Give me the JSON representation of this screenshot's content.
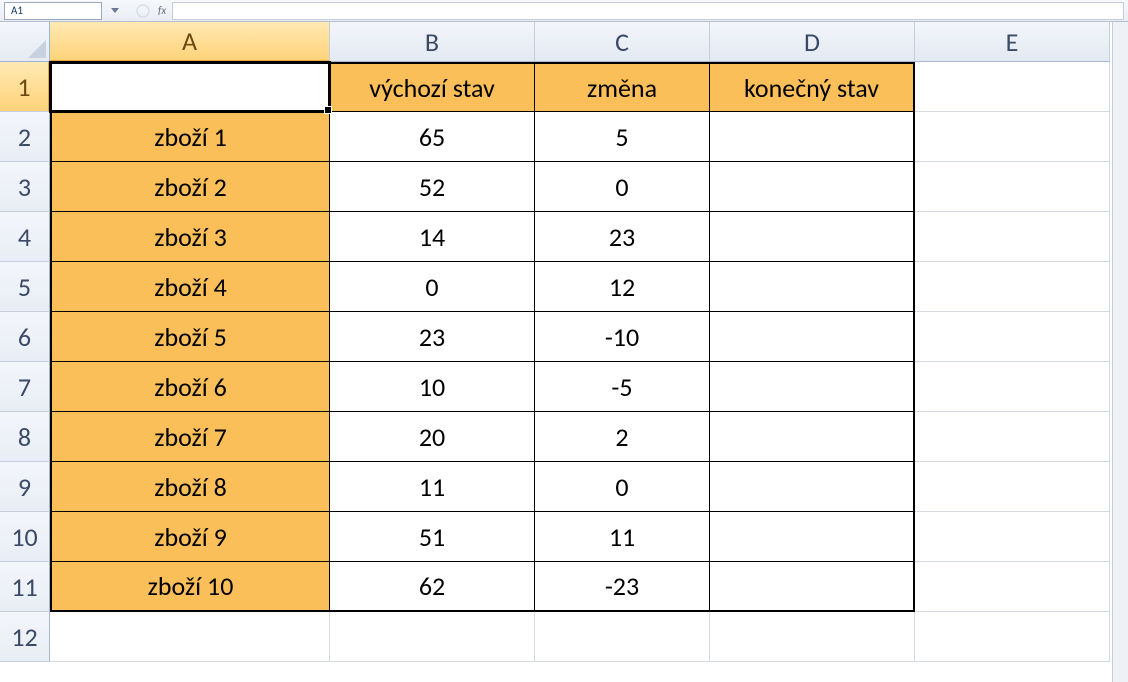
{
  "nameBox": {
    "value": "A1"
  },
  "fxLabel": "fx",
  "columns": [
    "A",
    "B",
    "C",
    "D",
    "E"
  ],
  "rowNumbers": [
    "1",
    "2",
    "3",
    "4",
    "5",
    "6",
    "7",
    "8",
    "9",
    "10",
    "11",
    "12"
  ],
  "activeCell": {
    "col": "A",
    "row": 1
  },
  "headers": {
    "A": "",
    "B": "výchozí stav",
    "C": "změna",
    "D": "konečný stav"
  },
  "rows": [
    {
      "label": "zboží 1",
      "B": 65,
      "C": 5,
      "D": ""
    },
    {
      "label": "zboží 2",
      "B": 52,
      "C": 0,
      "D": ""
    },
    {
      "label": "zboží 3",
      "B": 14,
      "C": 23,
      "D": ""
    },
    {
      "label": "zboží 4",
      "B": 0,
      "C": 12,
      "D": ""
    },
    {
      "label": "zboží 5",
      "B": 23,
      "C": -10,
      "D": ""
    },
    {
      "label": "zboží 6",
      "B": 10,
      "C": -5,
      "D": ""
    },
    {
      "label": "zboží 7",
      "B": 20,
      "C": 2,
      "D": ""
    },
    {
      "label": "zboží 8",
      "B": 11,
      "C": 0,
      "D": ""
    },
    {
      "label": "zboží 9",
      "B": 51,
      "C": 11,
      "D": ""
    },
    {
      "label": "zboží 10",
      "B": 62,
      "C": -23,
      "D": ""
    }
  ],
  "colors": {
    "accent": "#fbbf5a",
    "gridHeader": "#e6ebf3"
  }
}
